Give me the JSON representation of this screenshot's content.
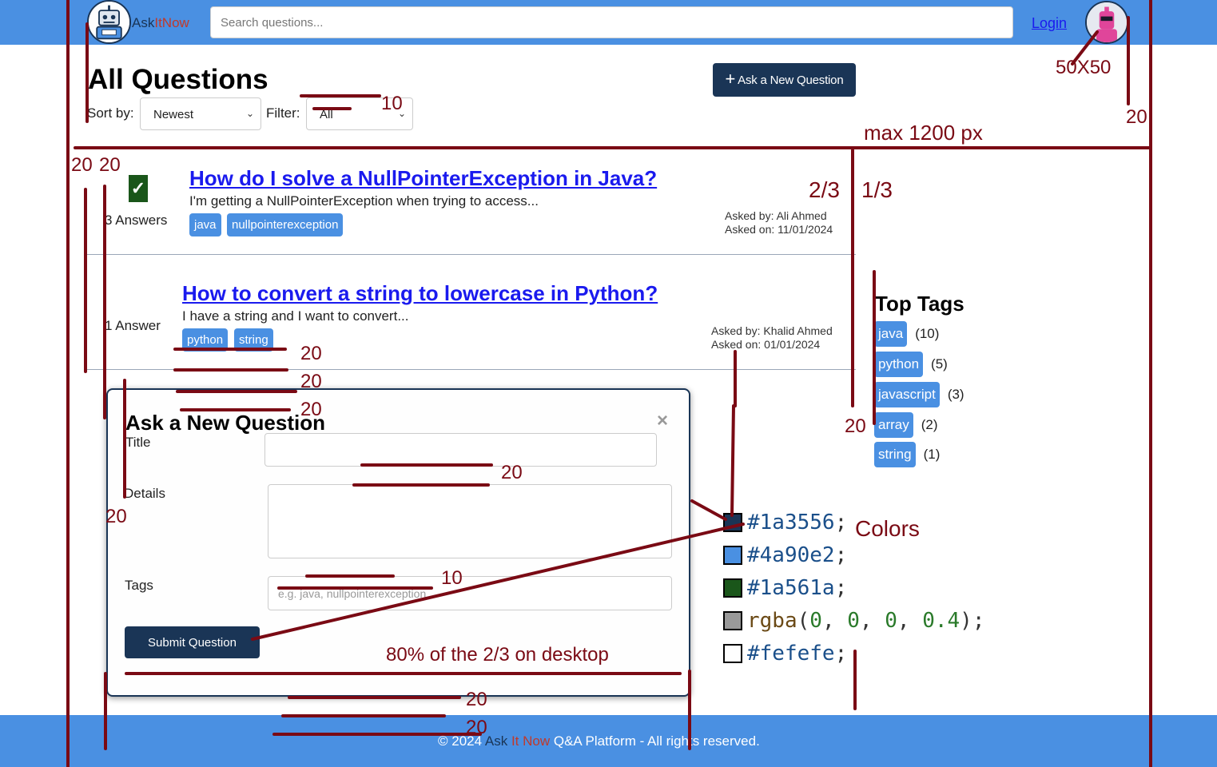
{
  "header": {
    "brand": "AskItNow",
    "brand_prefix": "Ask",
    "brand_suffix": "ItNow",
    "search_placeholder": "Search questions...",
    "login": "Login",
    "logo_icon": "robot-logo-icon",
    "avatar_icon": "user-avatar-icon"
  },
  "page": {
    "title": "All Questions",
    "ask_button": "Ask a New Question",
    "sort_label": "Sort by:",
    "sort_value": "Newest",
    "filter_label": "Filter:",
    "filter_value": "All"
  },
  "questions": [
    {
      "answers": "3 Answers",
      "accepted": true,
      "title": "How do I solve a NullPointerException in Java?",
      "description": "I'm getting a NullPointerException when trying to access...",
      "tags": [
        "java",
        "nullpointerexception"
      ],
      "asked_by": "Asked by: Ali Ahmed",
      "asked_on": "Asked on: 11/01/2024"
    },
    {
      "answers": "1 Answer",
      "accepted": false,
      "title": "How to convert a string to lowercase in Python?",
      "description": "I have a string and I want to convert...",
      "tags": [
        "python",
        "string"
      ],
      "asked_by": "Asked by: Khalid Ahmed",
      "asked_on": "Asked on: 01/01/2024"
    }
  ],
  "modal": {
    "title": "Ask a New Question",
    "close": "×",
    "title_label": "Title",
    "details_label": "Details",
    "tags_label": "Tags",
    "tags_placeholder": "e.g. java, nullpointerexception",
    "submit": "Submit Question"
  },
  "top_tags": {
    "title": "Top Tags",
    "items": [
      {
        "name": "java",
        "count": "(10)"
      },
      {
        "name": "python",
        "count": "(5)"
      },
      {
        "name": "javascript",
        "count": "(3)"
      },
      {
        "name": "array",
        "count": "(2)"
      },
      {
        "name": "string",
        "count": "(1)"
      }
    ]
  },
  "footer": {
    "prefix": "© 2024",
    "ask": "Ask",
    "it_now": "It Now",
    "suffix": "Q&A Platform - All rights reserved."
  },
  "annotations": {
    "avatar_size": "50X50",
    "max_width": "max 1200 px",
    "col_left": "2/3",
    "col_right": "1/3",
    "n20": "20",
    "n10": "10",
    "colors_label": "Colors",
    "modal_width": "80% of the 2/3",
    "modal_width_suffix": "on desktop",
    "colors": [
      {
        "hex": "#1a3556",
        "code": "#1a3556",
        "semi": ";"
      },
      {
        "hex": "#4a90e2",
        "code": "#4a90e2",
        "semi": ";"
      },
      {
        "hex": "#1a561a",
        "code": "#1a561a",
        "semi": ";"
      },
      {
        "hex": "rgba(0,0,0,0.4)",
        "code": "rgba",
        "semi": ";"
      },
      {
        "hex": "#fefefe",
        "code": "#fefefe",
        "semi": ";"
      }
    ],
    "rgba_args": [
      "0",
      "0",
      "0",
      "0.4"
    ]
  },
  "palette": {
    "primary": "#1a3556",
    "accent": "#4a90e2",
    "success": "#1a561a",
    "overlay": "rgba(0, 0, 0, 0.4)",
    "surface": "#fefefe",
    "annotation": "#7a0a14"
  }
}
